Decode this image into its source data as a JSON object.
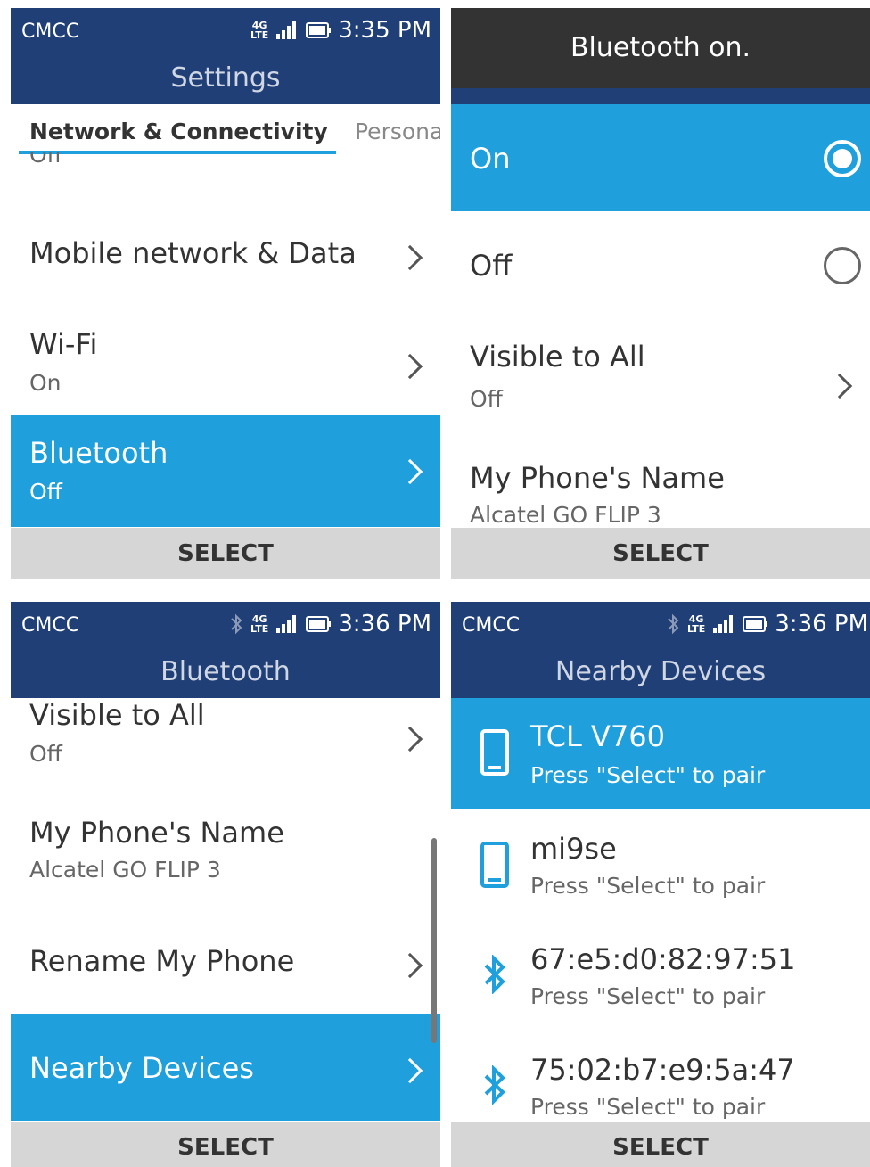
{
  "screen1": {
    "carrier": "CMCC",
    "net_top": "4G",
    "net_bottom": "LTE",
    "time": "3:35 PM",
    "title": "Settings",
    "tabs": {
      "active": "Network & Connectivity",
      "next": "Persona"
    },
    "partial_above": "Off",
    "items": [
      {
        "title": "Mobile network & Data"
      },
      {
        "title": "Wi-Fi",
        "subtitle": "On"
      },
      {
        "title": "Bluetooth",
        "subtitle": "Off"
      }
    ],
    "softkey": "SELECT"
  },
  "screen2": {
    "toast": "Bluetooth on.",
    "options": [
      {
        "label": "On",
        "selected": true
      },
      {
        "label": "Off",
        "selected": false
      }
    ],
    "visible": {
      "title": "Visible to All",
      "subtitle": "Off"
    },
    "phone_name": {
      "title": "My Phone's Name",
      "subtitle": "Alcatel GO FLIP 3"
    },
    "softkey": "SELECT"
  },
  "screen3": {
    "carrier": "CMCC",
    "net_top": "4G",
    "net_bottom": "LTE",
    "time": "3:36 PM",
    "title": "Bluetooth",
    "items": [
      {
        "title": "Visible to All",
        "subtitle": "Off"
      },
      {
        "title": "My Phone's Name",
        "subtitle": "Alcatel GO FLIP 3"
      },
      {
        "title": "Rename My Phone"
      },
      {
        "title": "Nearby Devices"
      }
    ],
    "softkey": "SELECT"
  },
  "screen4": {
    "carrier": "CMCC",
    "net_top": "4G",
    "net_bottom": "LTE",
    "time": "3:36 PM",
    "title": "Nearby Devices",
    "devices": [
      {
        "name": "TCL V760",
        "hint": "Press \"Select\" to pair",
        "icon": "phone-icon"
      },
      {
        "name": "mi9se",
        "hint": "Press \"Select\" to pair",
        "icon": "phone-icon"
      },
      {
        "name": "67:e5:d0:82:97:51",
        "hint": "Press \"Select\" to pair",
        "icon": "bluetooth-icon"
      },
      {
        "name": "75:02:b7:e9:5a:47",
        "hint": "Press \"Select\" to pair",
        "icon": "bluetooth-icon"
      }
    ],
    "softkey": "SELECT"
  },
  "colors": {
    "header": "#1f3f76",
    "accent": "#1fa0dd",
    "softkey_bar": "#d6d6d6",
    "toast": "#333333"
  }
}
